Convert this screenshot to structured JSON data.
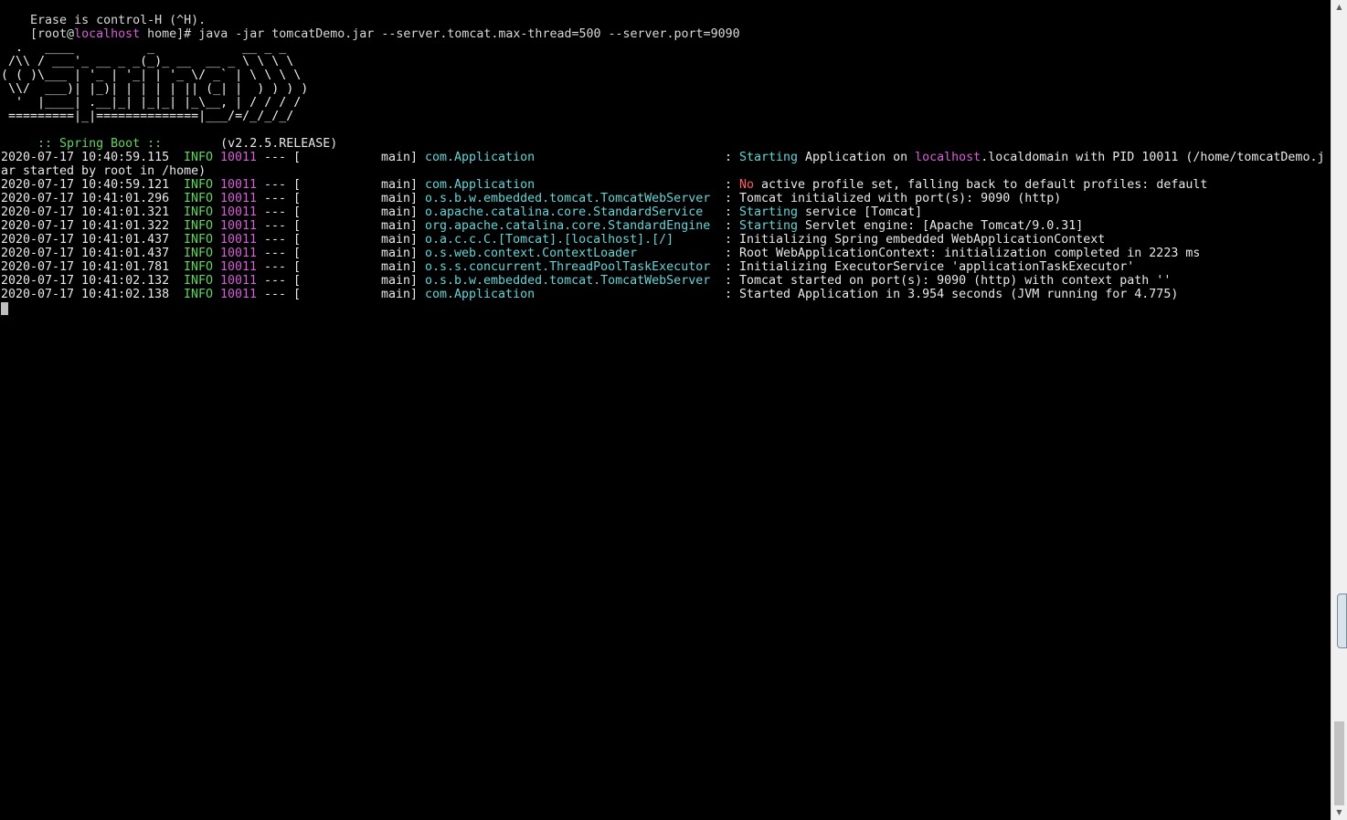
{
  "terminal": {
    "pre_lines": [
      "Erase is control-H (^H)."
    ],
    "prompt": {
      "open": "[root@",
      "host": "localhost",
      "rest": " home]# ",
      "command": "java -jar tomcatDemo.jar --server.tomcat.max-thread=500 --server.port=9090"
    },
    "banner": [
      "  .   ____          _            __ _ _",
      " /\\\\ / ___'_ __ _ _(_)_ __  __ _ \\ \\ \\ \\",
      "( ( )\\___ | '_ | '_| | '_ \\/ _` | \\ \\ \\ \\",
      " \\\\/  ___)| |_)| | | | | || (_| |  ) ) ) )",
      "  '  |____| .__|_| |_|_| |_\\__, | / / / /",
      " =========|_|==============|___/=/_/_/_/"
    ],
    "spring_label": " :: Spring Boot :: ",
    "spring_version": "       (v2.2.5.RELEASE)",
    "log_entries": [
      {
        "timestamp": "2020-07-17 10:40:59.115",
        "level": "INFO",
        "pid": "10011",
        "sep": "--- [",
        "thread": "main]",
        "logger": "com.Application",
        "colon": ":",
        "msg_parts": [
          {
            "text": "Starting",
            "color": "cyan"
          },
          {
            "text": " Application on ",
            "color": "white"
          },
          {
            "text": "localhost",
            "color": "magenta"
          },
          {
            "text": ".localdomain with PID 10011 (/home/tomcatDemo.j",
            "color": "white"
          }
        ],
        "continuation": "ar started by root in /home)"
      },
      {
        "timestamp": "2020-07-17 10:40:59.121",
        "level": "INFO",
        "pid": "10011",
        "sep": "--- [",
        "thread": "main]",
        "logger": "com.Application",
        "colon": ":",
        "msg_parts": [
          {
            "text": "No",
            "color": "red"
          },
          {
            "text": " active profile set, falling back to default profiles: default",
            "color": "white"
          }
        ]
      },
      {
        "timestamp": "2020-07-17 10:41:01.296",
        "level": "INFO",
        "pid": "10011",
        "sep": "--- [",
        "thread": "main]",
        "logger": "o.s.b.w.embedded.tomcat.TomcatWebServer",
        "colon": ":",
        "msg_parts": [
          {
            "text": "Tomcat initialized with port(s): 9090 (http)",
            "color": "white"
          }
        ]
      },
      {
        "timestamp": "2020-07-17 10:41:01.321",
        "level": "INFO",
        "pid": "10011",
        "sep": "--- [",
        "thread": "main]",
        "logger": "o.apache.catalina.core.StandardService",
        "colon": ":",
        "msg_parts": [
          {
            "text": "Starting",
            "color": "cyan"
          },
          {
            "text": " service [Tomcat]",
            "color": "white"
          }
        ]
      },
      {
        "timestamp": "2020-07-17 10:41:01.322",
        "level": "INFO",
        "pid": "10011",
        "sep": "--- [",
        "thread": "main]",
        "logger": "org.apache.catalina.core.StandardEngine",
        "colon": ":",
        "msg_parts": [
          {
            "text": "Starting",
            "color": "cyan"
          },
          {
            "text": " Servlet engine: [Apache Tomcat/9.0.31]",
            "color": "white"
          }
        ]
      },
      {
        "timestamp": "2020-07-17 10:41:01.437",
        "level": "INFO",
        "pid": "10011",
        "sep": "--- [",
        "thread": "main]",
        "logger": "o.a.c.c.C.[Tomcat].[localhost].[/]",
        "colon": ":",
        "msg_parts": [
          {
            "text": "Initializing Spring embedded WebApplicationContext",
            "color": "white"
          }
        ]
      },
      {
        "timestamp": "2020-07-17 10:41:01.437",
        "level": "INFO",
        "pid": "10011",
        "sep": "--- [",
        "thread": "main]",
        "logger": "o.s.web.context.ContextLoader",
        "colon": ":",
        "msg_parts": [
          {
            "text": "Root WebApplicationContext: initialization completed in 2223 ms",
            "color": "white"
          }
        ]
      },
      {
        "timestamp": "2020-07-17 10:41:01.781",
        "level": "INFO",
        "pid": "10011",
        "sep": "--- [",
        "thread": "main]",
        "logger": "o.s.s.concurrent.ThreadPoolTaskExecutor",
        "colon": ":",
        "msg_parts": [
          {
            "text": "Initializing ExecutorService 'applicationTaskExecutor'",
            "color": "white"
          }
        ]
      },
      {
        "timestamp": "2020-07-17 10:41:02.132",
        "level": "INFO",
        "pid": "10011",
        "sep": "--- [",
        "thread": "main]",
        "logger": "o.s.b.w.embedded.tomcat.TomcatWebServer",
        "colon": ":",
        "msg_parts": [
          {
            "text": "Tomcat started on port(s): 9090 (http) with context path ''",
            "color": "white"
          }
        ]
      },
      {
        "timestamp": "2020-07-17 10:41:02.138",
        "level": "INFO",
        "pid": "10011",
        "sep": "--- [",
        "thread": "main]",
        "logger": "com.Application",
        "colon": ":",
        "msg_parts": [
          {
            "text": "Started Application in 3.954 seconds (JVM running for 4.775)",
            "color": "white"
          }
        ]
      }
    ]
  },
  "scrollbar": {
    "up_arrow_icon": "triangle-up-icon",
    "down_arrow_icon": "triangle-down-icon",
    "up_glyph": "▲",
    "down_glyph": "▼"
  },
  "colors": {
    "background": "#000000",
    "text": "#d9d9d9",
    "green": "#5fd75f",
    "magenta": "#d75fd7",
    "cyan": "#5fd7d7",
    "red": "#ff5f5f"
  }
}
